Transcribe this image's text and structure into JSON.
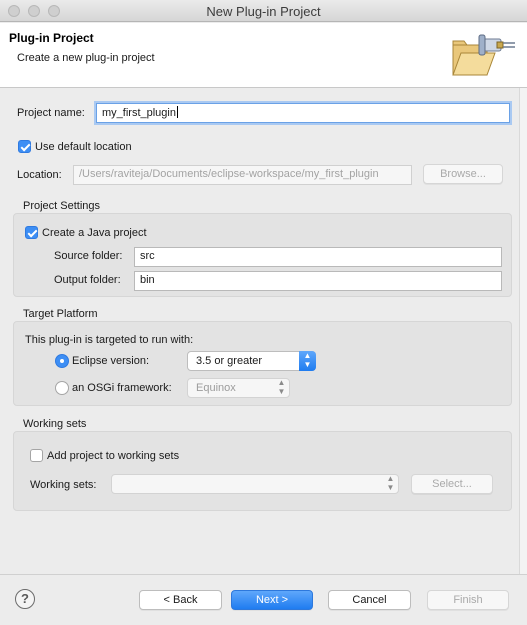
{
  "window": {
    "title": "New Plug-in Project"
  },
  "header": {
    "title": "Plug-in Project",
    "description": "Create a new plug-in project",
    "icon": "plugin-folder-wizard-icon"
  },
  "project": {
    "name_label": "Project name:",
    "name_value": "my_first_plugin",
    "use_default_location_label": "Use default location",
    "use_default_location_checked": true,
    "location_label": "Location:",
    "location_value": "/Users/raviteja/Documents/eclipse-workspace/my_first_plugin",
    "browse_label": "Browse..."
  },
  "project_settings": {
    "group_label": "Project Settings",
    "create_java_label": "Create a Java project",
    "create_java_checked": true,
    "source_folder_label": "Source folder:",
    "source_folder_value": "src",
    "output_folder_label": "Output folder:",
    "output_folder_value": "bin"
  },
  "target_platform": {
    "group_label": "Target Platform",
    "intro": "This plug-in is targeted to run with:",
    "eclipse_label": "Eclipse version:",
    "eclipse_selected": true,
    "eclipse_version": "3.5 or greater",
    "osgi_label": "an OSGi framework:",
    "osgi_value": "Equinox"
  },
  "working_sets": {
    "group_label": "Working sets",
    "add_label": "Add project to working sets",
    "add_checked": false,
    "sets_label": "Working sets:",
    "sets_value": "",
    "select_label": "Select..."
  },
  "footer": {
    "help_glyph": "?",
    "back_label": "< Back",
    "next_label": "Next >",
    "cancel_label": "Cancel",
    "finish_label": "Finish"
  },
  "colors": {
    "accent": "#1f7cf0",
    "focus_ring": "#a9c9f2"
  }
}
